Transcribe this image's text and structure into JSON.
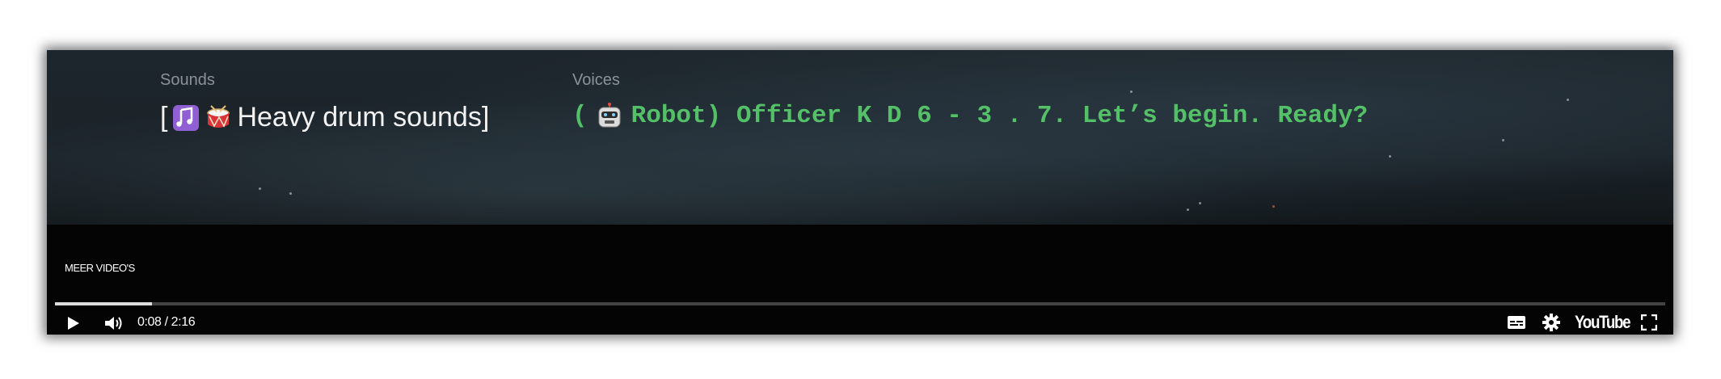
{
  "captions": {
    "sounds_label": "Sounds",
    "sounds_open_bracket": "[",
    "sounds_text": "Heavy drum sounds]",
    "sounds_icons": [
      "musical-notes-icon",
      "drum-icon"
    ],
    "voices_label": "Voices",
    "voices_open": "(",
    "voices_icon": "robot-icon",
    "voices_text": "Robot) Officer K D 6 - 3 . 7. Let’s begin. Ready?"
  },
  "player": {
    "more_videos_label": "MEER VIDEO'S",
    "time_display": "0:08 / 2:16",
    "progress_fraction": 0.06,
    "brand_label": "YouTube"
  },
  "colors": {
    "voice_caption": "#54c067",
    "sound_caption": "#f2f2f2",
    "player_bg": "#040404"
  }
}
